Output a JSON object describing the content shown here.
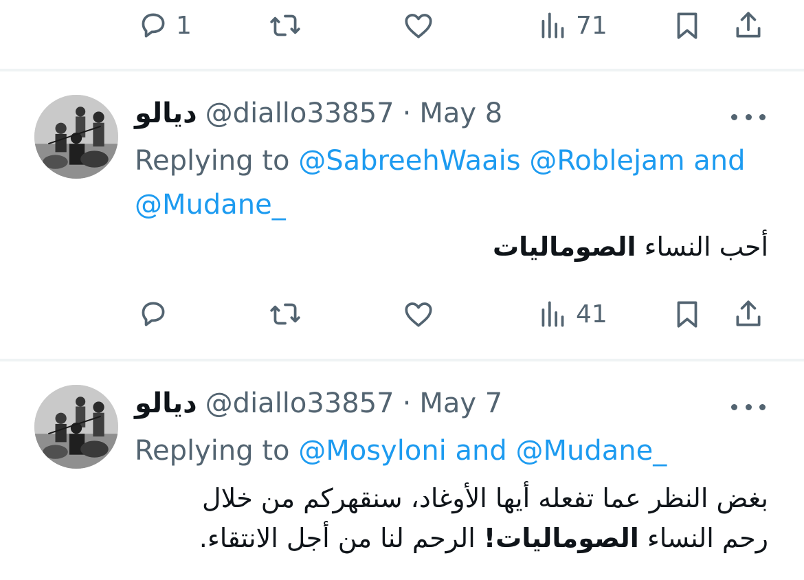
{
  "top_actions": {
    "reply_count": "1",
    "views_count": "71"
  },
  "tweets": [
    {
      "display_name": "ديالو",
      "handle": "@diallo33857",
      "separator": "·",
      "date": "May 8",
      "replying_prefix": "Replying to",
      "mention_1": "@SabreehWaais",
      "mention_2": "@Roblejam",
      "and_word": "and",
      "mention_3": "@Mudane_",
      "text_normal": "أحب النساء ",
      "text_bold": "الصوماليات",
      "views_count": "41"
    },
    {
      "display_name": "ديالو",
      "handle": "@diallo33857",
      "separator": "·",
      "date": "May 7",
      "replying_prefix": "Replying to",
      "mention_1": "@Mosyloni",
      "and_word": "and",
      "mention_2": "@Mudane_",
      "text_line1": "بغض النظر عما تفعله أيها الأوغاد، سنقهركم من خلال",
      "text_line2_a": "رحم النساء ",
      "text_line2_bold": "الصوماليات!",
      "text_line2_b": " الرحم لنا من أجل الانتقاء."
    }
  ],
  "icons": [
    "reply-icon",
    "retweet-icon",
    "like-icon",
    "views-icon",
    "bookmark-icon",
    "share-icon",
    "more-icon"
  ],
  "colors": {
    "link": "#1d9bf0",
    "secondary": "#536471",
    "primary": "#0f1419",
    "divider": "#eff3f4"
  }
}
